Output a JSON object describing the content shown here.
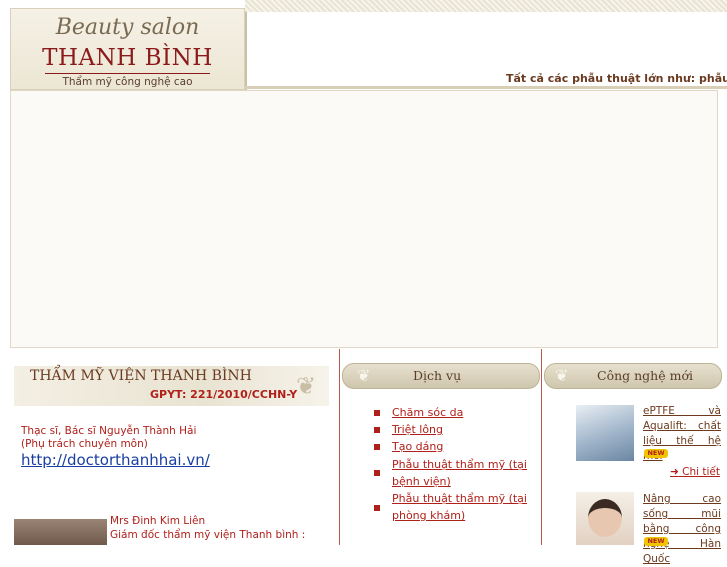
{
  "header": {
    "logo_script": "Beauty salon",
    "logo_name": "THANH BÌNH",
    "logo_tagline": "Thẩm mỹ công nghệ cao",
    "marquee": "Tất cả các phẫu thuật lớn như: phẫu t"
  },
  "left": {
    "title": "THẨM MỸ VIỆN THANH BÌNH",
    "license": "GPYT: 221/2010/CCHN-Y",
    "doctor_name": "Thạc sĩ, Bác sĩ Nguyễn Thành Hải",
    "doctor_role": "(Phụ trách chuyên môn)",
    "doctor_link": "http://doctorthanhhai.vn/",
    "director_name": "Mrs Đinh Kim Liên",
    "director_role": "Giám đốc thẩm mỹ viện Thanh bình :"
  },
  "services": {
    "title": "Dịch vụ",
    "items": [
      "Chăm sóc da",
      "Triệt lông",
      "Tạo dáng",
      "Phẫu thuật thẩm mỹ (tại bệnh viện)",
      "Phẫu thuật thẩm mỹ (tại phòng khám)"
    ]
  },
  "tech": {
    "title": "Công nghệ mới",
    "item1_text": "ePTFE và Aqualift: chất liệu thế hệ mới",
    "item2_text": "Nâng cao sống mũi bằng công nghệ Hàn Quốc",
    "new_badge": "NEW",
    "detail_label": "Chi tiết",
    "detail_icon": "arrow-right-icon"
  },
  "colors": {
    "accent_red": "#b0201a",
    "brown": "#6b3a1f",
    "link_blue": "#1a3fa3"
  }
}
